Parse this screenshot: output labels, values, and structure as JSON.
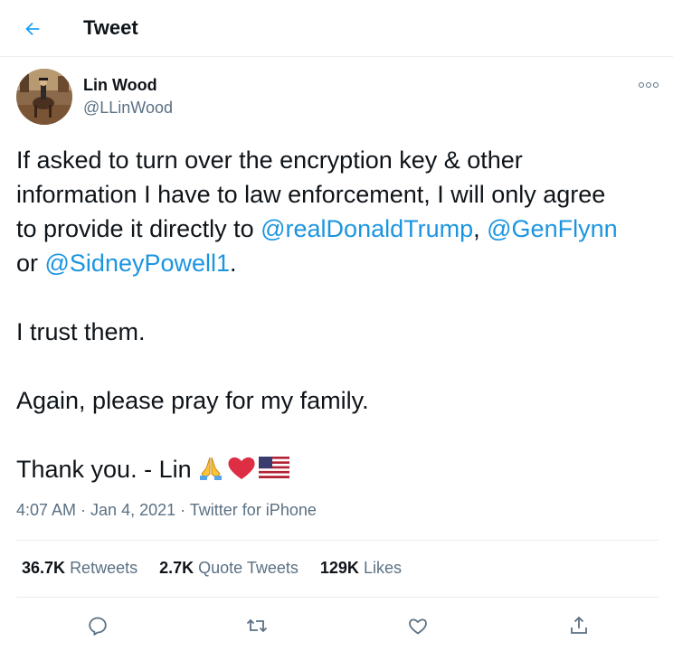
{
  "header": {
    "title": "Tweet",
    "back_icon": "back-arrow-icon",
    "accent_color": "#1da1f2"
  },
  "author": {
    "display_name": "Lin Wood",
    "handle": "@LLinWood",
    "avatar": "avatar-photo"
  },
  "tweet": {
    "line1": "If asked to turn over the encryption key & other",
    "line2": "information I have to law enforcement, I will only agree",
    "line3_prefix": "to provide it directly to ",
    "mention1": "@realDonaldTrump",
    "comma": ", ",
    "mention2": "@GenFlynn",
    "line4_prefix": "or ",
    "mention3": "@SidneyPowell1",
    "line4_suffix": ".",
    "para2": "I trust them.",
    "para3": "Again, please pray for my family.",
    "para4": "Thank you. - Lin",
    "emojis": [
      "folded-hands-emoji",
      "red-heart-emoji",
      "us-flag-emoji"
    ],
    "mention_color": "#1b95e0"
  },
  "meta": {
    "time": "4:07 AM",
    "sep1": " · ",
    "date": "Jan 4, 2021",
    "sep2": " · ",
    "source": "Twitter for iPhone"
  },
  "stats": {
    "retweets_count": "36.7K",
    "retweets_label": "Retweets",
    "quotes_count": "2.7K",
    "quotes_label": "Quote Tweets",
    "likes_count": "129K",
    "likes_label": "Likes"
  },
  "actions": [
    "reply-icon",
    "retweet-icon",
    "like-icon",
    "share-icon"
  ]
}
